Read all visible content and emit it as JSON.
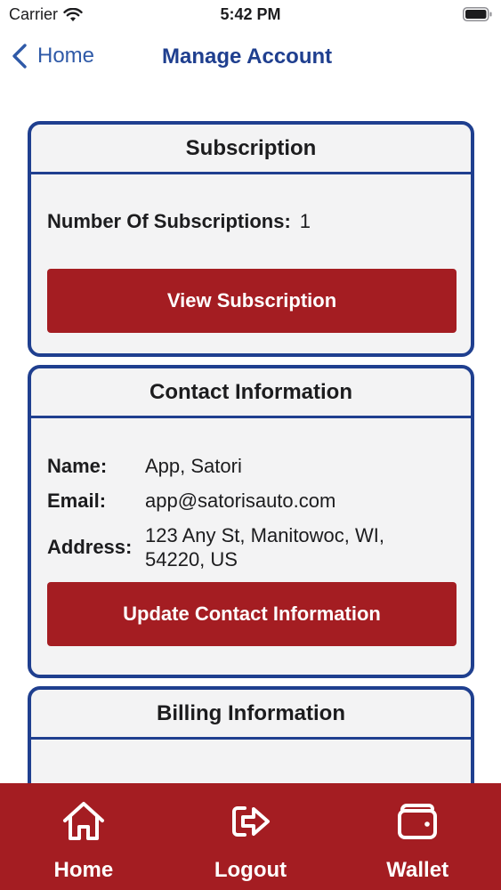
{
  "status_bar": {
    "carrier": "Carrier",
    "time": "5:42 PM"
  },
  "nav": {
    "back_label": "Home",
    "title": "Manage Account"
  },
  "subscription": {
    "title": "Subscription",
    "count_label": "Number Of Subscriptions:",
    "count_value": "1",
    "button_label": "View Subscription"
  },
  "contact": {
    "title": "Contact Information",
    "name_label": "Name:",
    "name_value": "App, Satori",
    "email_label": "Email:",
    "email_value": "app@satorisauto.com",
    "address_label": "Address:",
    "address_value": "123 Any St, Manitowoc, WI, 54220, US",
    "button_label": "Update Contact Information"
  },
  "billing": {
    "title": "Billing Information"
  },
  "tab_bar": {
    "items": [
      {
        "label": "Home",
        "icon": "home-icon"
      },
      {
        "label": "Logout",
        "icon": "logout-icon"
      },
      {
        "label": "Wallet",
        "icon": "wallet-icon"
      }
    ]
  },
  "colors": {
    "brand_red": "#a41d22",
    "brand_blue": "#1f3f8f",
    "link_blue": "#2f5aa8"
  }
}
